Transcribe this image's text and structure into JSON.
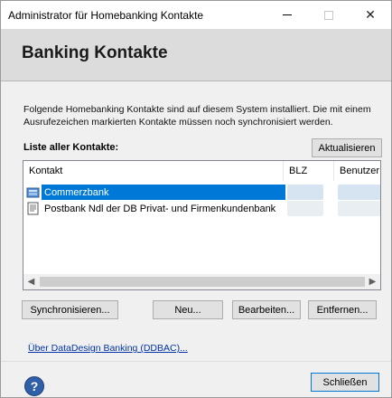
{
  "window": {
    "title": "Administrator für Homebanking Kontakte",
    "min_glyph": "",
    "close_glyph": "✕"
  },
  "header": {
    "title": "Banking Kontakte"
  },
  "description": "Folgende Homebanking Kontakte sind auf diesem System installiert. Die mit einem Ausrufezeichen markierten Kontakte müssen noch synchronisiert werden.",
  "list": {
    "label": "Liste aller Kontakte:",
    "columns": [
      "Kontakt",
      "BLZ",
      "Benutzer"
    ],
    "rows": [
      {
        "name": "Commerzbank",
        "selected": true,
        "icon": "bank-contact-icon"
      },
      {
        "name": "Postbank Ndl der DB Privat- und Firmenkundenbank",
        "selected": false,
        "icon": "document-contact-icon"
      }
    ]
  },
  "buttons": {
    "refresh": "Aktualisieren",
    "sync": "Synchronisieren...",
    "new": "Neu...",
    "edit": "Bearbeiten...",
    "remove": "Entfernen...",
    "close": "Schließen"
  },
  "link": "Über DataDesign Banking (DDBAC)...",
  "colors": {
    "selection": "#0078d7",
    "header_band": "#dcdcdc",
    "link": "#0033aa"
  }
}
